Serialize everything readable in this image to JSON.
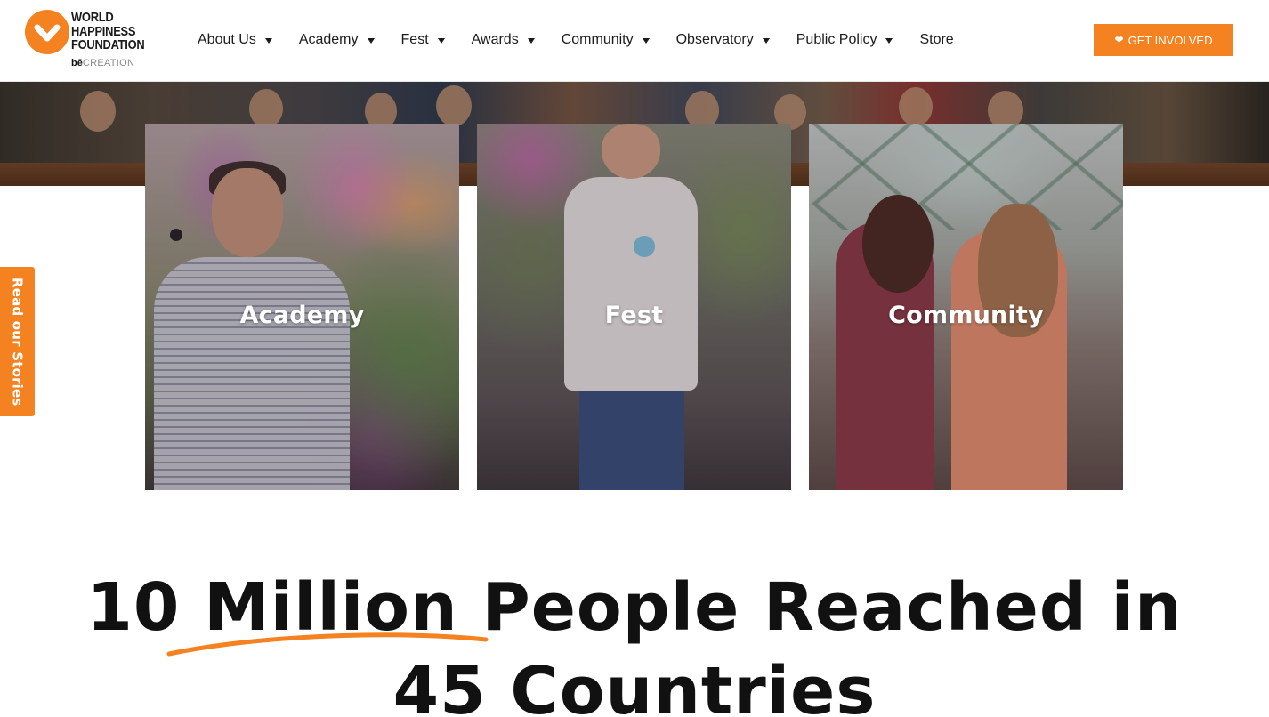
{
  "header": {
    "logo": {
      "line1": "WORLD",
      "line2": "HAPPINESS",
      "line3": "FOUNDATION",
      "sub_brand": "bē",
      "sub_text": "CREATION"
    },
    "nav": [
      {
        "label": "About Us",
        "has_dropdown": true
      },
      {
        "label": "Academy",
        "has_dropdown": true
      },
      {
        "label": "Fest",
        "has_dropdown": true
      },
      {
        "label": "Awards",
        "has_dropdown": true
      },
      {
        "label": "Community",
        "has_dropdown": true
      },
      {
        "label": "Observatory",
        "has_dropdown": true
      },
      {
        "label": "Public Policy",
        "has_dropdown": true
      },
      {
        "label": "Store",
        "has_dropdown": false
      }
    ],
    "cta": {
      "label": "GET INVOLVED",
      "icon": "heart-icon"
    }
  },
  "cards": [
    {
      "label": "Academy"
    },
    {
      "label": "Fest"
    },
    {
      "label": "Community"
    }
  ],
  "side_tab": {
    "label": "Read our Stories"
  },
  "headline": {
    "line1": "10 Million People Reached in",
    "line2": "45 Countries",
    "underlined_text": "10 Million"
  },
  "colors": {
    "accent": "#f58220",
    "text": "#111111",
    "background": "#ffffff"
  }
}
